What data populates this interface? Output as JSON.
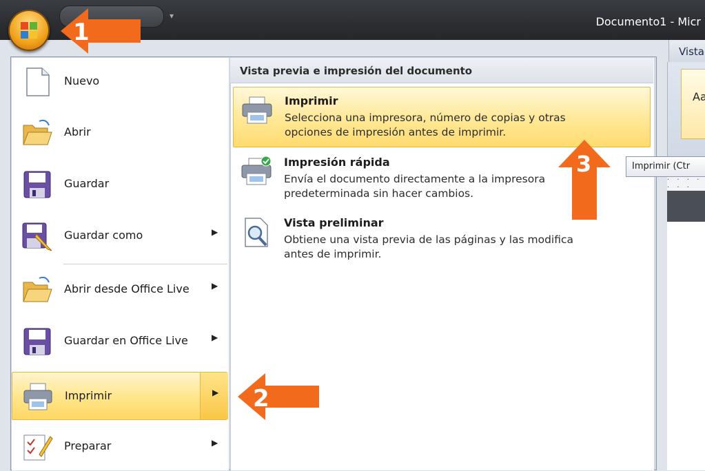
{
  "window": {
    "title": "Documento1 - Micr"
  },
  "ribbon": {
    "tab_label": "Vista",
    "style_sample": "Aa"
  },
  "tooltip": {
    "text": "Imprimir (Ctr"
  },
  "left_menu": {
    "items": [
      {
        "label": "Nuevo"
      },
      {
        "label": "Abrir"
      },
      {
        "label": "Guardar"
      },
      {
        "label": "Guardar como"
      },
      {
        "label": "Abrir desde Office Live"
      },
      {
        "label": "Guardar en Office Live"
      },
      {
        "label": "Imprimir"
      },
      {
        "label": "Preparar"
      }
    ]
  },
  "right_pane": {
    "header": "Vista previa e impresión del documento",
    "items": [
      {
        "title": "Imprimir",
        "description": "Selecciona una impresora, número de copias y otras opciones de impresión antes de imprimir."
      },
      {
        "title": "Impresión rápida",
        "description": "Envía el documento directamente a la impresora predeterminada sin hacer cambios."
      },
      {
        "title": "Vista preliminar",
        "description": "Obtiene una vista previa de las páginas y las modifica antes de imprimir."
      }
    ]
  },
  "callouts": {
    "step1": "1",
    "step2": "2",
    "step3": "3"
  },
  "colors": {
    "arrow": "#f26a1b",
    "highlight": "#ffe68e"
  }
}
